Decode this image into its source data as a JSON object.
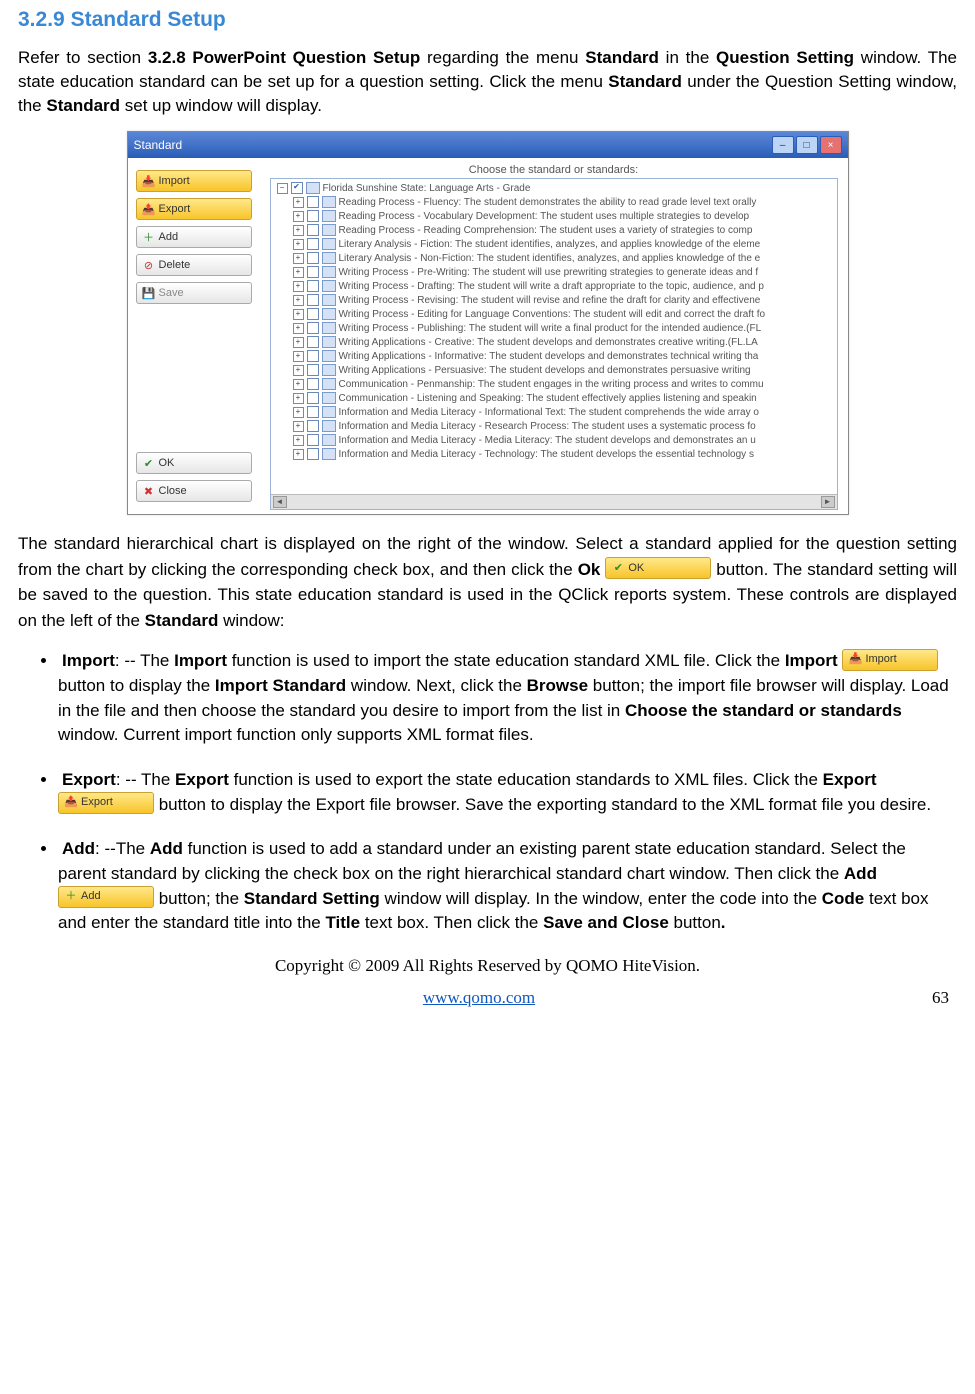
{
  "section": {
    "number": "3.2.9",
    "title": "Standard Setup"
  },
  "intro": {
    "pre": "Refer to section ",
    "ref": "3.2.8 PowerPoint Question Setup",
    "mid1": " regarding the menu ",
    "b1": "Standard",
    "mid2": " in the ",
    "b2": "Question Setting",
    "mid3": " window. The state education standard can be set up for a question setting. Click the menu ",
    "b3": "Standard",
    "mid4": " under the Question Setting window, the ",
    "b4": "Standard",
    "end": " set up window will display."
  },
  "window": {
    "title": "Standard",
    "label": "Choose the standard or standards:",
    "sidebar": {
      "import": "Import",
      "export": "Export",
      "add": "Add",
      "delete": "Delete",
      "save": "Save",
      "ok": "OK",
      "close": "Close"
    },
    "root": "Florida Sunshine State: Language Arts - Grade",
    "items": [
      "Reading Process - Fluency: The student demonstrates the ability to read grade level text orally",
      "Reading Process - Vocabulary Development: The student uses multiple strategies to develop",
      "Reading Process - Reading Comprehension: The student uses a variety of strategies to comp",
      "Literary Analysis - Fiction: The student identifies, analyzes, and applies knowledge of the eleme",
      "Literary Analysis - Non-Fiction: The student identifies, analyzes, and applies knowledge of the e",
      "Writing Process - Pre-Writing: The student will use prewriting strategies to generate ideas and f",
      "Writing Process - Drafting: The student will write a draft appropriate to the topic, audience, and p",
      "Writing Process - Revising: The student will revise and refine the draft for clarity and effectivene",
      "Writing Process - Editing for Language Conventions: The student will edit and correct the draft fo",
      "Writing Process - Publishing: The student will write a final product for the intended audience.(FL",
      "Writing Applications - Creative: The student develops and demonstrates creative writing.(FL.LA",
      "Writing Applications - Informative: The student develops and demonstrates technical writing tha",
      "Writing Applications - Persuasive: The student develops and demonstrates persuasive writing",
      "Communication - Penmanship: The student engages in the writing process and writes to commu",
      "Communication - Listening and Speaking: The student effectively applies listening and speakin",
      "Information and Media Literacy - Informational Text: The student comprehends the wide array o",
      "Information and Media Literacy - Research Process: The student uses a systematic process fo",
      "Information and Media Literacy - Media Literacy: The student develops and demonstrates an u",
      "Information and Media Literacy - Technology: The student develops the essential technology s"
    ]
  },
  "middle": {
    "p1a": "The standard hierarchical chart is displayed on the right of the window. Select a standard applied for the question setting from the chart by clicking the corresponding check box, and then click the ",
    "p1b": "Ok",
    "ok_label": "OK",
    "p2a": " button. The standard setting will be saved to the question. This state education standard is used in the QClick reports system. These controls are displayed on the left of the ",
    "p2b": "Standard",
    "p2c": " window:"
  },
  "bullets": {
    "import": {
      "name": "Import",
      "t1": ": -- The ",
      "t2": " function is used to import the state education standard XML file. Click the ",
      "btn": "Import",
      "t3": " button to display the ",
      "b1": "Import Standard",
      "t4": " window. Next, click the ",
      "b2": "Browse",
      "t5": " button; the import file browser will display. Load in the file and then choose the standard you desire to import from the list in ",
      "b3": "Choose the standard or standards",
      "t6": " window. Current import function only supports XML format files."
    },
    "export": {
      "name": "Export",
      "t1": ": -- The ",
      "t2": " function is used to export the state education standards to XML files. Click the ",
      "btn": "Export",
      "t3": " button to display the Export file browser. Save the exporting standard to the XML format file you desire."
    },
    "add": {
      "name": "Add",
      "t1": ": --The ",
      "t2": " function is used to add a standard under an existing parent state education standard. Select the parent standard by clicking the check box on the right hierarchical standard chart window. Then click the ",
      "btn": "Add",
      "t3": " button; the ",
      "b1": "Standard Setting",
      "t4": " window will display. In the window, enter the code into the ",
      "b2": "Code",
      "t5": " text box and enter the standard title into the ",
      "b3": "Title",
      "t6": " text box. Then click the ",
      "b4": "Save and Close",
      "t7": " button",
      "t8": "."
    }
  },
  "footer": {
    "copyright": "Copyright © 2009 All Rights Reserved by QOMO HiteVision.",
    "url": "www.qomo.com",
    "page": "63"
  }
}
